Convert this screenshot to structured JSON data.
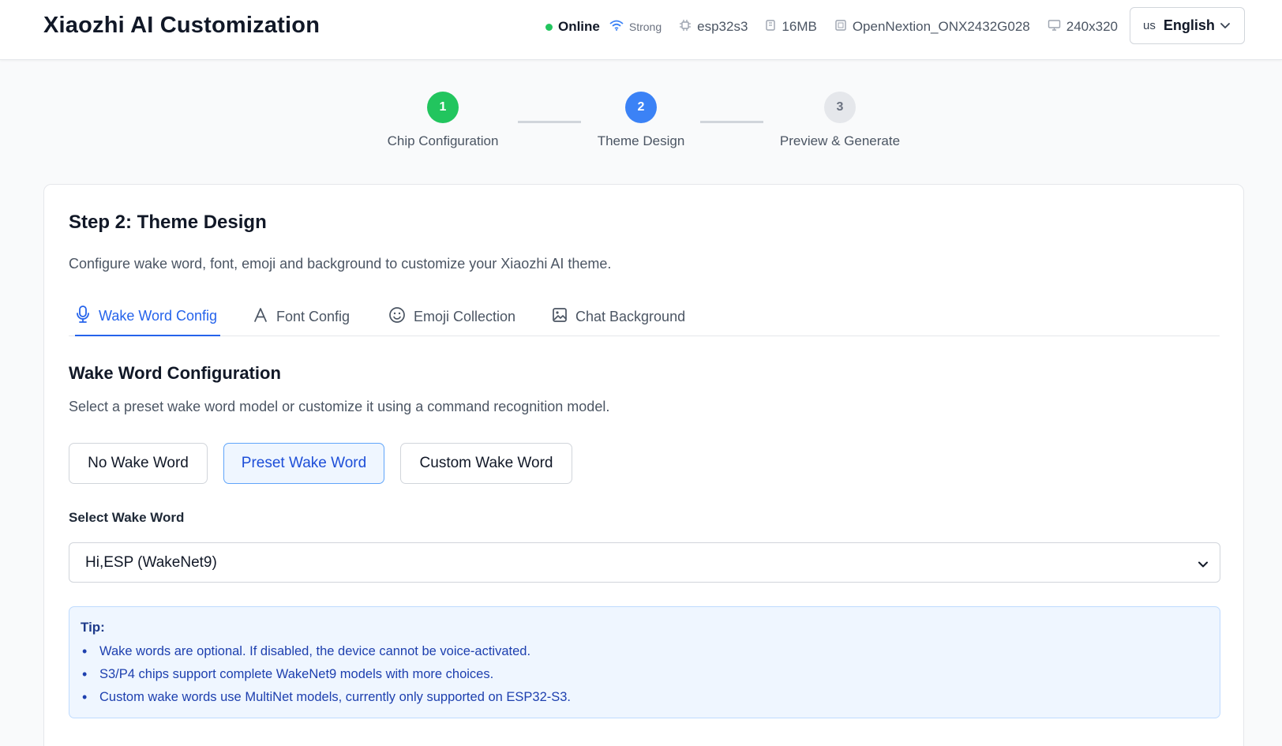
{
  "header": {
    "title": "Xiaozhi AI Customization",
    "status": {
      "online": "Online",
      "signal": "Strong",
      "chip": "esp32s3",
      "flash": "16MB",
      "board": "OpenNextion_ONX2432G028",
      "resolution": "240x320"
    },
    "language": {
      "code": "us",
      "label": "English"
    }
  },
  "stepper": {
    "steps": [
      {
        "number": "1",
        "label": "Chip Configuration",
        "state": "completed",
        "color": "#22c55e"
      },
      {
        "number": "2",
        "label": "Theme Design",
        "state": "active",
        "color": "#3b82f6"
      },
      {
        "number": "3",
        "label": "Preview & Generate",
        "state": "pending",
        "color": "#e5e7eb"
      }
    ]
  },
  "card": {
    "title": "Step 2: Theme Design",
    "description": "Configure wake word, font, emoji and background to customize your Xiaozhi AI theme.",
    "tabs": [
      {
        "label": "Wake Word Config",
        "icon": "microphone-icon",
        "active": true
      },
      {
        "label": "Font Config",
        "icon": "font-icon",
        "active": false
      },
      {
        "label": "Emoji Collection",
        "icon": "smiley-icon",
        "active": false
      },
      {
        "label": "Chat Background",
        "icon": "image-icon",
        "active": false
      }
    ],
    "section": {
      "title": "Wake Word Configuration",
      "description": "Select a preset wake word model or customize it using a command recognition model.",
      "options": [
        {
          "label": "No Wake Word",
          "active": false
        },
        {
          "label": "Preset Wake Word",
          "active": true
        },
        {
          "label": "Custom Wake Word",
          "active": false
        }
      ],
      "select_label": "Select Wake Word",
      "select_value": "Hi,ESP (WakeNet9)"
    },
    "tip": {
      "title": "Tip:",
      "items": [
        "Wake words are optional. If disabled, the device cannot be voice-activated.",
        "S3/P4 chips support complete WakeNet9 models with more choices.",
        "Custom wake words use MultiNet models, currently only supported on ESP32-S3."
      ]
    }
  },
  "colors": {
    "accent": "#2563eb",
    "success": "#22c55e",
    "tip_bg": "#eff6ff"
  }
}
